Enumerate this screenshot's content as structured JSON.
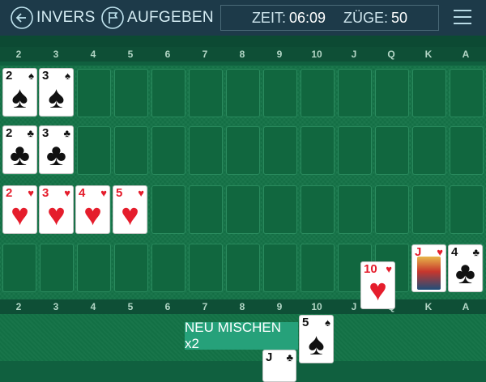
{
  "header": {
    "undo_label": "INVERS",
    "giveup_label": "AUFGEBEN",
    "time_label": "ZEIT:",
    "time_value": "06:09",
    "moves_label": "ZÜGE:",
    "moves_value": "50"
  },
  "ranks": [
    "2",
    "3",
    "4",
    "5",
    "6",
    "7",
    "8",
    "9",
    "10",
    "J",
    "Q",
    "K",
    "A"
  ],
  "cards": {
    "spade_2": {
      "rank": "2",
      "suit": "♠"
    },
    "spade_3": {
      "rank": "3",
      "suit": "♠"
    },
    "club_2": {
      "rank": "2",
      "suit": "♣"
    },
    "club_3": {
      "rank": "3",
      "suit": "♣"
    },
    "heart_2": {
      "rank": "2",
      "suit": "♥"
    },
    "heart_3": {
      "rank": "3",
      "suit": "♥"
    },
    "heart_4": {
      "rank": "4",
      "suit": "♥"
    },
    "heart_5": {
      "rank": "5",
      "suit": "♥"
    },
    "heart_10": {
      "rank": "10",
      "suit": "♥"
    },
    "heart_j": {
      "rank": "J",
      "suit": "♥"
    },
    "club_4": {
      "rank": "4",
      "suit": "♣"
    },
    "spade_5": {
      "rank": "5",
      "suit": "♠"
    },
    "club_j_partial": {
      "rank": "J",
      "suit": "♣"
    }
  },
  "action_button": "NEU MISCHEN x2",
  "colors": {
    "felt": "#137246",
    "topbar": "#1d3a49",
    "button": "#26a17a",
    "red_suit": "#e51d2c"
  },
  "icons": {
    "undo": "arrow-left-circle-icon",
    "giveup": "flag-circle-icon",
    "menu": "hamburger-menu-icon"
  }
}
